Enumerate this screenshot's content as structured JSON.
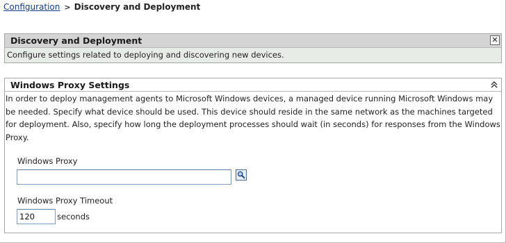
{
  "breadcrumb": {
    "parent": "Configuration",
    "separator": ">",
    "current": "Discovery and Deployment"
  },
  "discovery_panel": {
    "title": "Discovery and Deployment",
    "description": "Configure settings related to deploying and discovering new devices.",
    "close_icon": "close-icon",
    "close_glyph": "✕"
  },
  "proxy_panel": {
    "title": "Windows Proxy Settings",
    "collapse_icon": "collapse-up-icon",
    "description": "In order to deploy management agents to Microsoft Windows devices, a managed device running Microsoft Windows may be needed. Specify what device should be used. This device should reside in the same network as the machines targeted for deployment. Also, specify how long the deployment processes should wait (in seconds) for responses from the Windows Proxy.",
    "proxy_label": "Windows Proxy",
    "proxy_value": "",
    "search_icon": "magnifier-icon",
    "timeout_label": "Windows Proxy Timeout",
    "timeout_value": "120",
    "timeout_unit": "seconds"
  },
  "colors": {
    "link": "#123a8c",
    "panel_header_bg": "#d4d4d4",
    "panel_body_bg": "#e8ece6",
    "border": "#a8a8a8",
    "input_border": "#7f9db9"
  }
}
